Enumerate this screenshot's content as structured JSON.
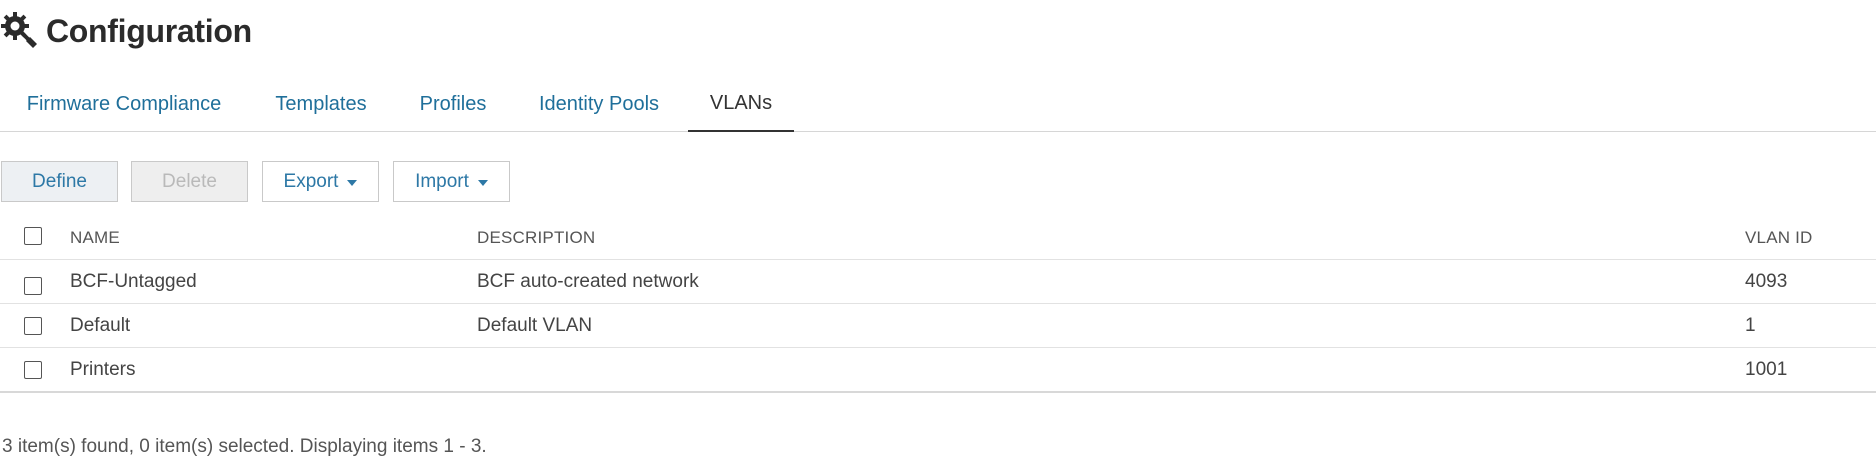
{
  "header": {
    "title": "Configuration",
    "icon": "gear-wrench-icon"
  },
  "tabs": [
    {
      "label": "Firmware Compliance",
      "active": false
    },
    {
      "label": "Templates",
      "active": false
    },
    {
      "label": "Profiles",
      "active": false
    },
    {
      "label": "Identity Pools",
      "active": false
    },
    {
      "label": "VLANs",
      "active": true
    }
  ],
  "toolbar": {
    "define_label": "Define",
    "delete_label": "Delete",
    "export_label": "Export",
    "import_label": "Import"
  },
  "table": {
    "columns": [
      "NAME",
      "DESCRIPTION",
      "VLAN ID"
    ],
    "rows": [
      {
        "name": "BCF-Untagged",
        "description": "BCF auto-created network",
        "vlan_id": "4093"
      },
      {
        "name": "Default",
        "description": "Default VLAN",
        "vlan_id": "1"
      },
      {
        "name": "Printers",
        "description": "",
        "vlan_id": "1001"
      }
    ]
  },
  "footer": {
    "status": "3 item(s) found, 0 item(s) selected. Displaying items 1 - 3."
  },
  "colors": {
    "link": "#1f6f9a",
    "button_text": "#2d78a6",
    "title": "#2b2b2b"
  }
}
